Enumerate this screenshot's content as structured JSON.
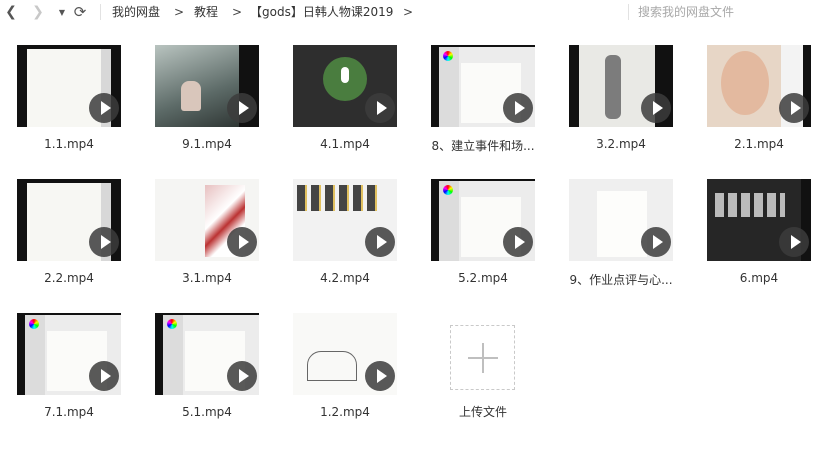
{
  "toolbar": {
    "back_glyph": "❮",
    "forward_glyph": "❯",
    "dropdown_glyph": "▼",
    "refresh_glyph": "⟳"
  },
  "breadcrumb": {
    "items": [
      "我的网盘",
      "教程",
      "【gods】日韩人物课2019"
    ],
    "separator": ">"
  },
  "search": {
    "placeholder": "搜索我的网盘文件"
  },
  "files": [
    {
      "name": "1.1.mp4",
      "thumb": "sketch-white"
    },
    {
      "name": "9.1.mp4",
      "thumb": "photo-girl"
    },
    {
      "name": "4.1.mp4",
      "thumb": "mic-dark"
    },
    {
      "name": "8、建立事件和场...",
      "thumb": "app-ui"
    },
    {
      "name": "3.2.mp4",
      "thumb": "figure-sketch"
    },
    {
      "name": "2.1.mp4",
      "thumb": "face-photo"
    },
    {
      "name": "2.2.mp4",
      "thumb": "sketch-white"
    },
    {
      "name": "3.1.mp4",
      "thumb": "sketch-color"
    },
    {
      "name": "4.2.mp4",
      "thumb": "folder-grid"
    },
    {
      "name": "5.2.mp4",
      "thumb": "app-ui"
    },
    {
      "name": "9、作业点评与心...",
      "thumb": "app-gray"
    },
    {
      "name": "6.mp4",
      "thumb": "dark-grid"
    },
    {
      "name": "7.1.mp4",
      "thumb": "app-ui"
    },
    {
      "name": "5.1.mp4",
      "thumb": "app-ui"
    },
    {
      "name": "1.2.mp4",
      "thumb": "line-art"
    }
  ],
  "upload": {
    "label": "上传文件"
  },
  "colors": {
    "background": "#ffffff",
    "thumb_bg": "#111111",
    "play_button": "#3c3c3c",
    "text": "#333333",
    "placeholder": "#a8a8a8"
  }
}
